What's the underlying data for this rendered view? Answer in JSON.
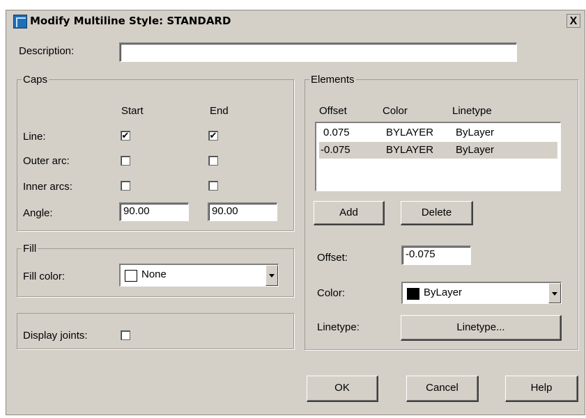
{
  "dialog": {
    "title": "Modify Multiline Style: STANDARD",
    "close_symbol": "X"
  },
  "description": {
    "label": "Description:",
    "value": ""
  },
  "caps": {
    "legend": "Caps",
    "start_header": "Start",
    "end_header": "End",
    "line_label": "Line:",
    "outer_arc_label": "Outer arc:",
    "inner_arcs_label": "Inner arcs:",
    "angle_label": "Angle:",
    "line_start_checked": true,
    "line_end_checked": true,
    "outer_arc_start_checked": false,
    "outer_arc_end_checked": false,
    "inner_arcs_start_checked": false,
    "inner_arcs_end_checked": false,
    "angle_start": "90.00",
    "angle_end": "90.00"
  },
  "fill": {
    "legend": "Fill",
    "label": "Fill color:",
    "value": "None",
    "swatch_color": "#ffffff"
  },
  "display_joints": {
    "label": "Display joints:",
    "checked": false
  },
  "elements": {
    "legend": "Elements",
    "columns": [
      "Offset",
      "Color",
      "Linetype"
    ],
    "rows": [
      {
        "offset": "0.075",
        "color": "BYLAYER",
        "linetype": "ByLayer",
        "selected": false
      },
      {
        "offset": "-0.075",
        "color": "BYLAYER",
        "linetype": "ByLayer",
        "selected": true
      }
    ],
    "add_label": "Add",
    "delete_label": "Delete",
    "offset_label": "Offset:",
    "offset_value": "-0.075",
    "color_label": "Color:",
    "color_value": "ByLayer",
    "color_swatch": "#000000",
    "linetype_label": "Linetype:",
    "linetype_button": "Linetype..."
  },
  "buttons": {
    "ok": "OK",
    "cancel": "Cancel",
    "help": "Help"
  },
  "icons": {
    "app": "multiline-style-icon",
    "check": "✔"
  }
}
